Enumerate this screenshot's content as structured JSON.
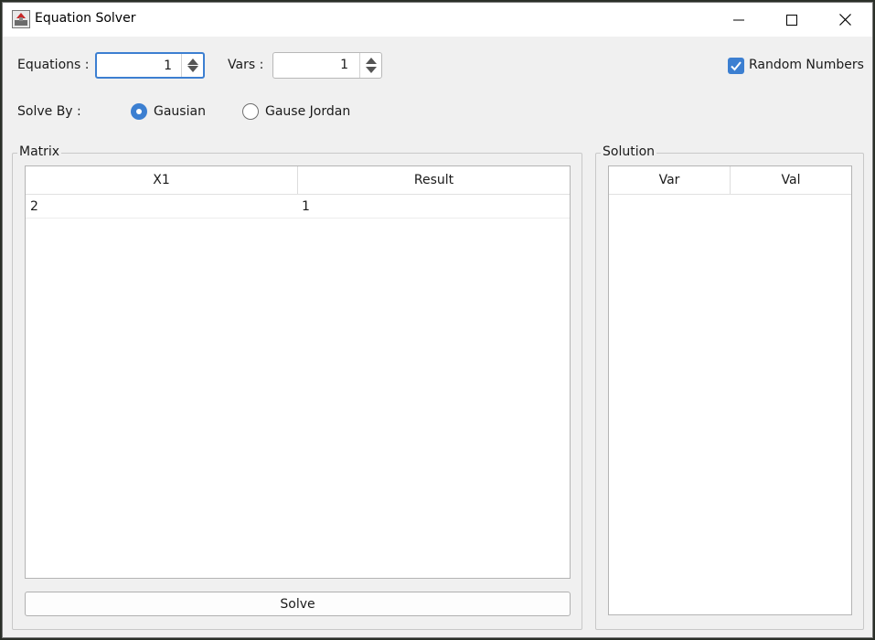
{
  "window": {
    "title": "Equation Solver",
    "icons": {
      "app": "app-icon",
      "minimize": "minimize-icon",
      "maximize": "maximize-icon",
      "close": "close-icon"
    }
  },
  "controls": {
    "equations_label": "Equations :",
    "equations_value": "1",
    "vars_label": "Vars :",
    "vars_value": "1",
    "random_numbers_label": "Random Numbers",
    "random_numbers_checked": true,
    "solve_by_label": "Solve By :",
    "methods": [
      {
        "label": "Gausian",
        "selected": true
      },
      {
        "label": "Gause Jordan",
        "selected": false
      }
    ]
  },
  "matrix": {
    "title": "Matrix",
    "columns": [
      "X1",
      "Result"
    ],
    "rows": [
      [
        "2",
        "1"
      ]
    ]
  },
  "solution": {
    "title": "Solution",
    "columns": [
      "Var",
      "Val"
    ],
    "rows": []
  },
  "solve_button": "Solve",
  "colors": {
    "accent": "#3c7fd1",
    "window_bg": "#f0f0f0",
    "titlebar_bg": "#ffffff"
  }
}
